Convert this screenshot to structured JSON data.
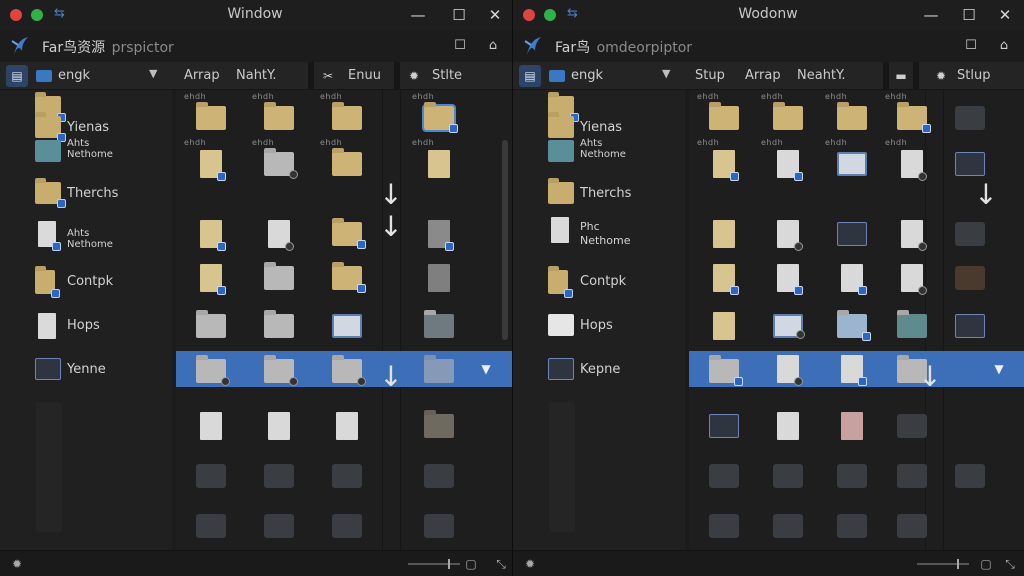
{
  "panes": [
    {
      "window_title": "Window",
      "app_title": "Far鸟资源",
      "app_subtitle": "prspictor",
      "sidebar_header": "engk",
      "tabs": [
        {
          "label": "Arrap"
        },
        {
          "label": "NahtY."
        },
        {
          "label": "Enuu"
        },
        {
          "label": "Stlte"
        }
      ],
      "sidebar_items": [
        {
          "label": "",
          "icon": "folder-icon"
        },
        {
          "label": "Yienas",
          "icon": "folder-icon"
        },
        {
          "label": "Ahts\nNethome",
          "icon": "folder-icon"
        },
        {
          "label": "Therchs",
          "icon": "folder-icon"
        },
        {
          "label": "Ahts\nNethome",
          "icon": "document-icon"
        },
        {
          "label": "Contpk",
          "icon": "folder-icon"
        },
        {
          "label": "Hops",
          "icon": "document-icon"
        },
        {
          "label": "Yenne",
          "icon": "folder-icon"
        }
      ],
      "grid_caption": "ehdh"
    },
    {
      "window_title": "Wodonw",
      "app_title": "Far鸟",
      "app_subtitle": "omdeorpiptor",
      "sidebar_header": "engk",
      "tabs": [
        {
          "label": "Stup"
        },
        {
          "label": "Arrap"
        },
        {
          "label": "NeahtY."
        },
        {
          "label": "Stlup"
        }
      ],
      "sidebar_items": [
        {
          "label": "",
          "icon": "folder-icon"
        },
        {
          "label": "Yienas",
          "icon": "folder-icon"
        },
        {
          "label": "Ahts\nNethome",
          "icon": "folder-icon"
        },
        {
          "label": "Therchs",
          "icon": "folder-icon"
        },
        {
          "label": "Phc\nNethome",
          "icon": "document-icon"
        },
        {
          "label": "Contpk",
          "icon": "folder-icon"
        },
        {
          "label": "Hops",
          "icon": "folder-icon"
        },
        {
          "label": "Kepne",
          "icon": "image-icon"
        }
      ],
      "grid_caption": "ehdh"
    }
  ]
}
